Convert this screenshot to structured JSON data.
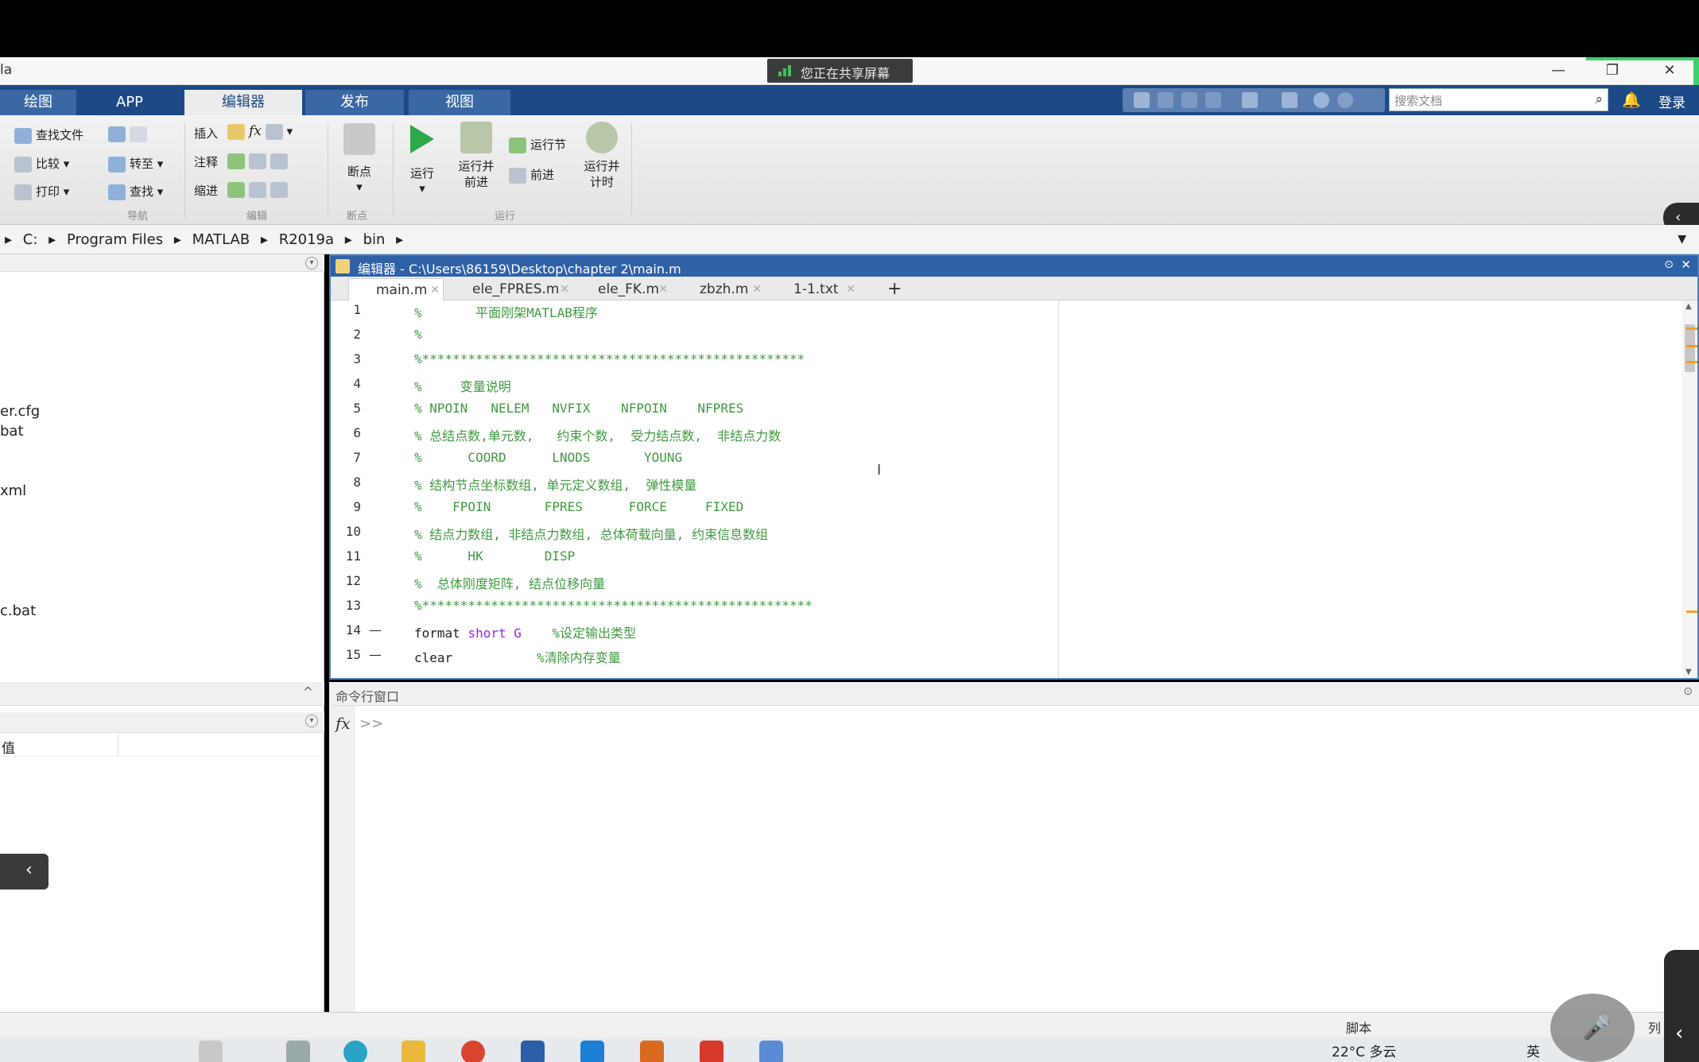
{
  "app_title": "la",
  "share_badge": "您正在共享屏幕",
  "window_controls": {
    "minimize": "—",
    "restore": "❐",
    "close": "✕"
  },
  "ribbon_tabs": [
    "绘图",
    "APP",
    "编辑器",
    "发布",
    "视图"
  ],
  "search": {
    "placeholder": "搜索文档"
  },
  "login_label": "登录",
  "ribbon": {
    "file_group": {
      "find_files": "查找文件",
      "compare": "比较",
      "print": "打印",
      "label": "导航"
    },
    "nav_group": {
      "goto": "转至",
      "find": "查找"
    },
    "edit_group": {
      "insert": "插入",
      "comment": "注释",
      "indent": "缩进",
      "fx": "fx",
      "label": "编辑"
    },
    "breakpoint_group": {
      "breakpoints": "断点",
      "label": "断点"
    },
    "run_group": {
      "run": "运行",
      "run_advance": "运行并\n前进",
      "run_section": "运行节",
      "advance": "前进",
      "run_time": "运行并\n计时",
      "label": "运行"
    }
  },
  "address": [
    "C:",
    "Program Files",
    "MATLAB",
    "R2019a",
    "bin"
  ],
  "left_files": [
    "er.cfg",
    "bat",
    "xml",
    "c.bat"
  ],
  "workspace_header": "值",
  "editor": {
    "title": "编辑器 - C:\\Users\\86159\\Desktop\\chapter 2\\main.m",
    "tabs": [
      "main.m",
      "ele_FPRES.m",
      "ele_FK.m",
      "zbzh.m",
      "1-1.txt"
    ],
    "lines": [
      {
        "n": "1",
        "dash": "",
        "code": [
          {
            "t": "%       平面刚架MATLAB程序",
            "c": "cmt"
          }
        ]
      },
      {
        "n": "2",
        "dash": "",
        "code": [
          {
            "t": "%",
            "c": "cmt"
          }
        ]
      },
      {
        "n": "3",
        "dash": "",
        "code": [
          {
            "t": "%**************************************************",
            "c": "cmt"
          }
        ]
      },
      {
        "n": "4",
        "dash": "",
        "code": [
          {
            "t": "%     变量说明",
            "c": "cmt"
          }
        ]
      },
      {
        "n": "5",
        "dash": "",
        "code": [
          {
            "t": "% NPOIN   NELEM   NVFIX    NFPOIN    NFPRES",
            "c": "cmt"
          }
        ]
      },
      {
        "n": "6",
        "dash": "",
        "code": [
          {
            "t": "% 总结点数,单元数,   约束个数,  受力结点数,  非结点力数",
            "c": "cmt"
          }
        ]
      },
      {
        "n": "7",
        "dash": "",
        "code": [
          {
            "t": "%      COORD      LNODS       YOUNG",
            "c": "cmt"
          }
        ]
      },
      {
        "n": "8",
        "dash": "",
        "code": [
          {
            "t": "% 结构节点坐标数组, 单元定义数组,  弹性模量",
            "c": "cmt"
          }
        ]
      },
      {
        "n": "9",
        "dash": "",
        "code": [
          {
            "t": "%    FPOIN       FPRES      FORCE     FIXED",
            "c": "cmt"
          }
        ]
      },
      {
        "n": "10",
        "dash": "",
        "code": [
          {
            "t": "% 结点力数组, 非结点力数组, 总体荷载向量, 约束信息数组",
            "c": "cmt"
          }
        ]
      },
      {
        "n": "11",
        "dash": "",
        "code": [
          {
            "t": "%      HK        DISP",
            "c": "cmt"
          }
        ]
      },
      {
        "n": "12",
        "dash": "",
        "code": [
          {
            "t": "%  总体刚度矩阵, 结点位移向量",
            "c": "cmt"
          }
        ]
      },
      {
        "n": "13",
        "dash": "",
        "code": [
          {
            "t": "%***************************************************",
            "c": "cmt"
          }
        ]
      },
      {
        "n": "14",
        "dash": "—",
        "code": [
          {
            "t": "format ",
            "c": "kw"
          },
          {
            "t": "short G",
            "c": "str"
          },
          {
            "t": "    %设定输出类型",
            "c": "cmt"
          }
        ]
      },
      {
        "n": "15",
        "dash": "—",
        "code": [
          {
            "t": "clear",
            "c": "kw"
          },
          {
            "t": "           %清除内存变量",
            "c": "cmt"
          }
        ]
      }
    ]
  },
  "command_window": {
    "title": "命令行窗口",
    "fx": "fx",
    "prompt": ">>"
  },
  "status": {
    "mode": "脚本",
    "col": "列"
  },
  "taskbar": {
    "weather": "22°C 多云",
    "lang": "英"
  }
}
